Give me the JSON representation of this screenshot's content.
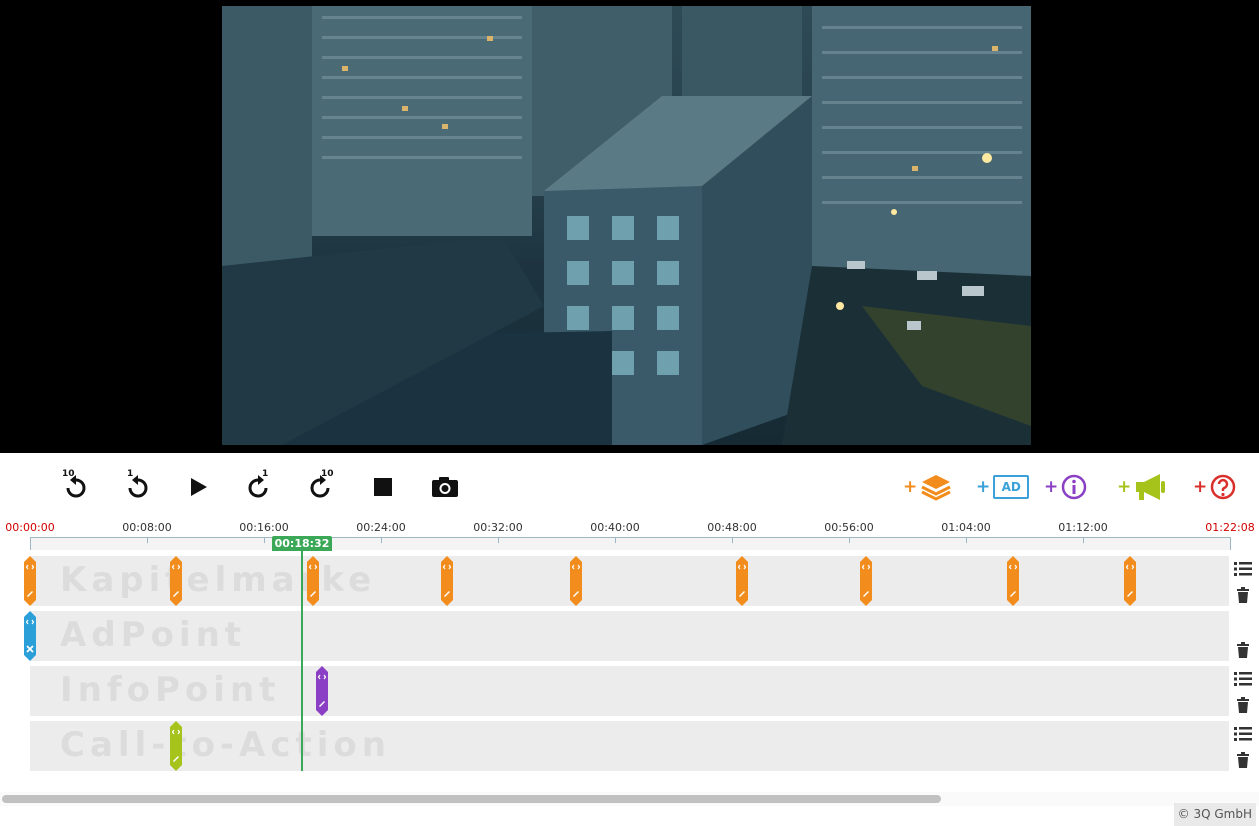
{
  "controls": {
    "rewind10_label": "10",
    "rewind1_label": "1",
    "forward1_label": "1",
    "forward10_label": "10",
    "ad_label": "AD",
    "add_plus": "+"
  },
  "timeline": {
    "start_time": "00:00:00",
    "end_time": "01:22:08",
    "ticks": [
      "00:08:00",
      "00:16:00",
      "00:24:00",
      "00:32:00",
      "00:40:00",
      "00:48:00",
      "00:56:00",
      "01:04:00",
      "01:12:00"
    ],
    "playhead_time": "00:18:32"
  },
  "tracks": {
    "chapter_label": "Kapitelmarke",
    "adpoint_label": "AdPoint",
    "infopoint_label": "InfoPoint",
    "cta_label": "Call-to-Action"
  },
  "colors": {
    "chapter": "#f28c1c",
    "adpoint": "#2a9fd8",
    "infopoint": "#8a3fc4",
    "cta": "#a6c31c",
    "help": "#d9302c",
    "playhead": "#3aa857",
    "ad_blue": "#3aa0d8"
  },
  "footer": {
    "copyright": "© 3Q GmbH"
  }
}
